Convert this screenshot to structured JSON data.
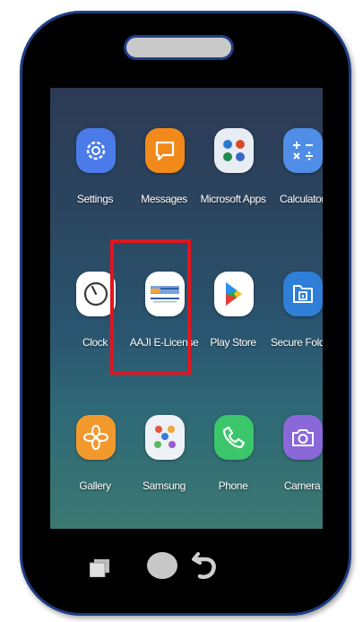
{
  "apps": [
    {
      "label": "Settings",
      "icon": "settings-gear-icon",
      "color": "#4b7be8"
    },
    {
      "label": "Messages",
      "icon": "chat-bubble-icon",
      "color": "#f28a1b"
    },
    {
      "label": "Microsoft Apps",
      "icon": "microsoft-apps-folder-icon",
      "color": "#e8edf4"
    },
    {
      "label": "Calculator",
      "icon": "calculator-icon",
      "color": "#4f8de6"
    },
    {
      "label": "Clock",
      "icon": "clock-icon",
      "color": "#ffffff"
    },
    {
      "label": "AAJI E-License",
      "icon": "aaji-logo-icon",
      "color": "#ffffff"
    },
    {
      "label": "Play Store",
      "icon": "play-store-icon",
      "color": "#ffffff"
    },
    {
      "label": "Secure Folder",
      "icon": "secure-folder-icon",
      "color": "#2f7fd8"
    },
    {
      "label": "Gallery",
      "icon": "gallery-flower-icon",
      "color": "#f2992e"
    },
    {
      "label": "Samsung",
      "icon": "samsung-folder-icon",
      "color": "#eef2f6"
    },
    {
      "label": "Phone",
      "icon": "phone-handset-icon",
      "color": "#3bc66b"
    },
    {
      "label": "Camera",
      "icon": "camera-icon",
      "color": "#8a68d8"
    }
  ],
  "highlight_color": "#e3141d",
  "phone_border_color": "#1f3d84",
  "navigation": {
    "recent": "recent-apps-icon",
    "home": "home-icon",
    "back": "back-arrow-icon"
  }
}
